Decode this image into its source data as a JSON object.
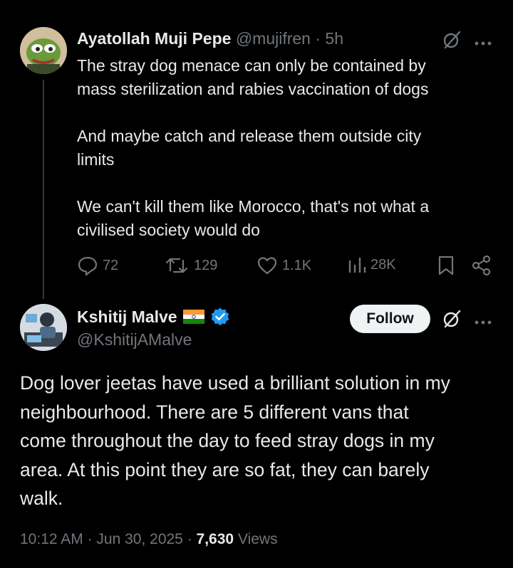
{
  "quoted_tweet": {
    "author_name": "Ayatollah Muji Pepe",
    "handle": "@mujifren",
    "separator": "·",
    "time": "5h",
    "paragraphs": [
      "The stray dog menace can only be contained by",
      "mass sterilization and rabies vaccination of dogs",
      "And maybe catch and release them outside city",
      "limits",
      "We can't kill them like Morocco, that's not what a",
      "civilised society would do"
    ],
    "replies": "72",
    "retweets": "129",
    "likes": "1.1K",
    "views": "28K"
  },
  "main_tweet": {
    "author_name": "Kshitij Malve",
    "handle": "@KshitijAMalve",
    "follow_label": "Follow",
    "text_lines": [
      "Dog lover jeetas have used a brilliant solution in my",
      "neighbourhood. There are 5 different vans that",
      "come throughout the day to feed stray dogs in my",
      "area. At this point they are so fat, they can barely",
      "walk."
    ],
    "time": "10:12 AM",
    "date": "Jun 30, 2025",
    "dot": "·",
    "views_count": "7,630",
    "views_label": "Views"
  },
  "colors": {
    "background": "#000000",
    "text": "#e7e9ea",
    "muted": "#71767b",
    "verified": "#1d9bf0",
    "follow_bg": "#eff3f4"
  },
  "icons": [
    "grok-icon",
    "more-icon",
    "reply-icon",
    "retweet-icon",
    "like-icon",
    "views-icon",
    "bookmark-icon",
    "share-icon",
    "verified-badge-icon",
    "india-flag-icon"
  ]
}
